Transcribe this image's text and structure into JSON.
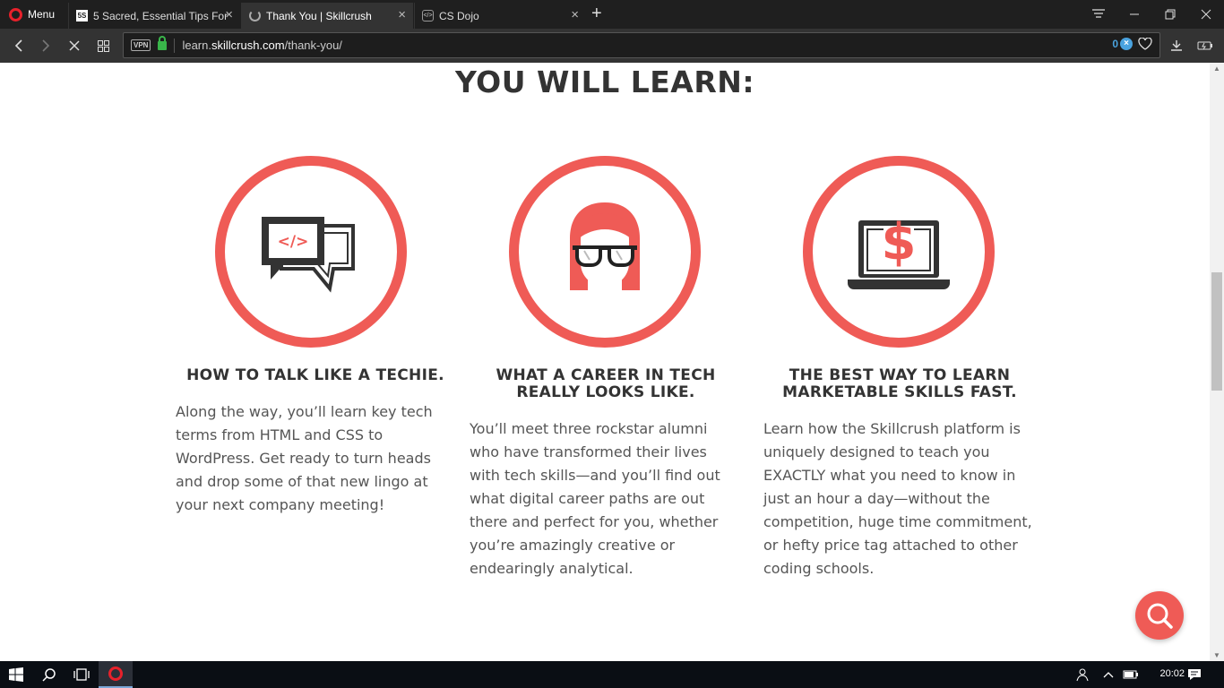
{
  "browser": {
    "menu_label": "Menu",
    "tabs": [
      {
        "title": "5 Sacred, Essential Tips For",
        "favicon": "5s-favicon",
        "active": false
      },
      {
        "title": "Thank You | Skillcrush",
        "favicon": "loading-spinner",
        "active": true
      },
      {
        "title": "CS Dojo",
        "favicon": "cs-dojo-favicon",
        "active": false
      }
    ],
    "address": {
      "vpn_label": "VPN",
      "url_prefix": "learn.",
      "url_host": "skillcrush.com",
      "url_path": "/thank-you/",
      "adblock_count": "0"
    }
  },
  "page": {
    "heading": "YOU WILL LEARN:",
    "columns": [
      {
        "icon": "code-speech-bubble-icon",
        "title_line1": "HOW TO TALK LIKE A TECHIE.",
        "title_line2": "",
        "text": "Along the way, you’ll learn key tech terms from HTML and CSS to WordPress. Get ready to turn heads and drop some of that new lingo at your next company meeting!"
      },
      {
        "icon": "woman-with-glasses-icon",
        "title_line1": "WHAT A CAREER IN TECH",
        "title_line2": "REALLY LOOKS LIKE.",
        "text": "You’ll meet three rockstar alumni who have transformed their lives with tech skills—and you’ll find out what digital career paths are out there and perfect for you, whether you’re amazingly creative or endearingly analytical."
      },
      {
        "icon": "laptop-dollar-icon",
        "title_line1": "THE BEST WAY TO LEARN",
        "title_line2": "MARKETABLE SKILLS FAST.",
        "text": "Learn how the Skillcrush platform is uniquely designed to teach you EXACTLY what you need to know in just an hour a day—without the competition, huge time commitment, or hefty price tag attached to other coding schools."
      }
    ]
  },
  "taskbar": {
    "clock": "20:02"
  },
  "colors": {
    "accent": "#ef5b56",
    "dark": "#333333",
    "browser_chrome": "#333333"
  }
}
